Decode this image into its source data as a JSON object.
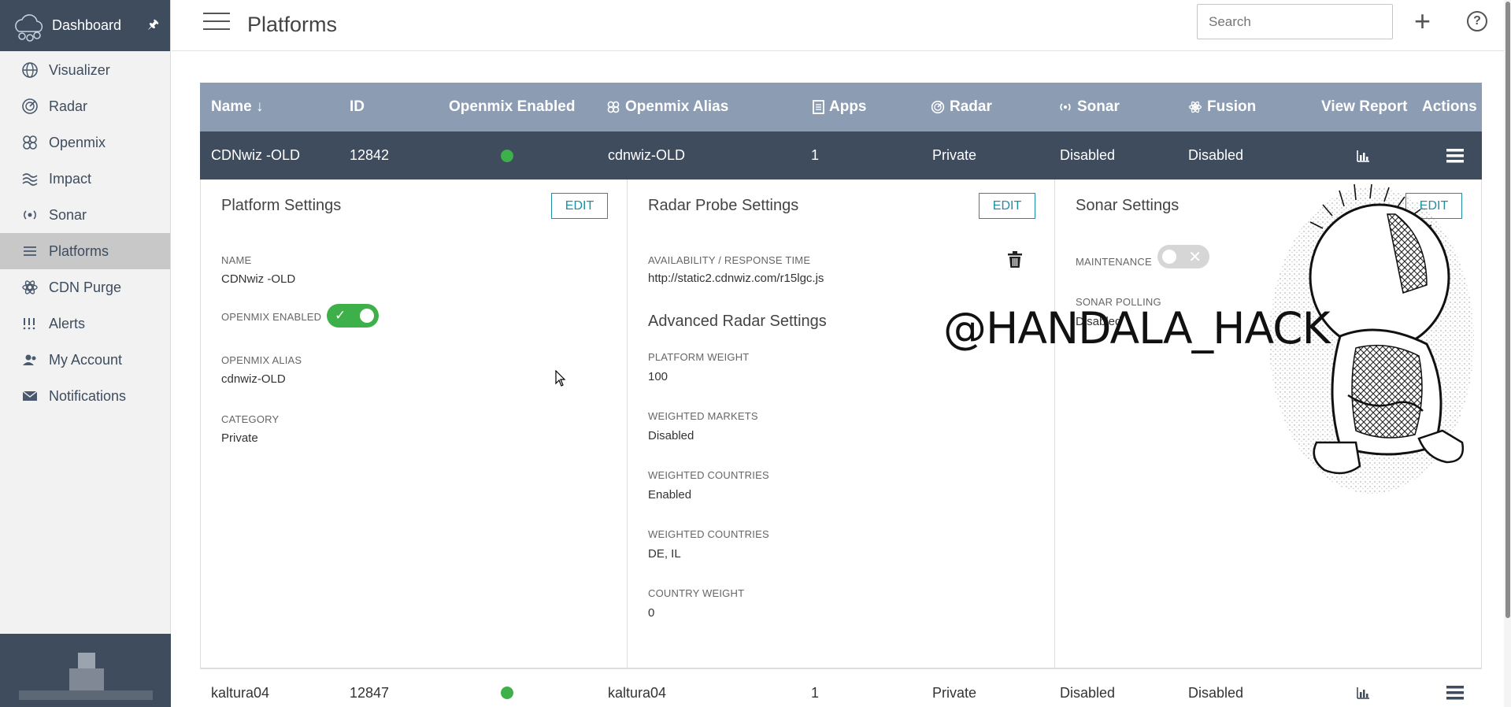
{
  "sidebar": {
    "title": "Dashboard",
    "items": [
      {
        "label": "Visualizer",
        "icon": "globe-icon"
      },
      {
        "label": "Radar",
        "icon": "radar-icon"
      },
      {
        "label": "Openmix",
        "icon": "openmix-icon"
      },
      {
        "label": "Impact",
        "icon": "impact-icon"
      },
      {
        "label": "Sonar",
        "icon": "sonar-icon"
      },
      {
        "label": "Platforms",
        "icon": "list-icon"
      },
      {
        "label": "CDN Purge",
        "icon": "purge-icon"
      },
      {
        "label": "Alerts",
        "icon": "alerts-icon"
      },
      {
        "label": "My Account",
        "icon": "account-icon"
      },
      {
        "label": "Notifications",
        "icon": "mail-icon"
      }
    ]
  },
  "header": {
    "title": "Platforms",
    "search_placeholder": "Search"
  },
  "table": {
    "columns": [
      "Name ↓",
      "ID",
      "Openmix Enabled",
      "Openmix Alias",
      "Apps",
      "Radar",
      "Sonar",
      "Fusion",
      "View Report",
      "Actions"
    ],
    "rows": [
      {
        "name": "CDNwiz -OLD",
        "id": "12842",
        "openmix_alias": "cdnwiz-OLD",
        "apps": "1",
        "radar": "Private",
        "sonar": "Disabled",
        "fusion": "Disabled"
      },
      {
        "name": "kaltura04",
        "id": "12847",
        "openmix_alias": "kaltura04",
        "apps": "1",
        "radar": "Private",
        "sonar": "Disabled",
        "fusion": "Disabled"
      }
    ]
  },
  "detail": {
    "edit_label": "EDIT",
    "platform": {
      "title": "Platform Settings",
      "name_label": "NAME",
      "name_value": "CDNwiz -OLD",
      "openmix_enabled_label": "OPENMIX ENABLED",
      "openmix_alias_label": "OPENMIX ALIAS",
      "openmix_alias_value": "cdnwiz-OLD",
      "category_label": "CATEGORY",
      "category_value": "Private"
    },
    "radar": {
      "title": "Radar Probe Settings",
      "availability_label": "AVAILABILITY / RESPONSE TIME",
      "availability_value": "http://static2.cdnwiz.com/r15lgc.js",
      "advanced_title": "Advanced Radar Settings",
      "platform_weight_label": "PLATFORM WEIGHT",
      "platform_weight_value": "100",
      "weighted_markets_label": "WEIGHTED MARKETS",
      "weighted_markets_value": "Disabled",
      "weighted_countries_label": "WEIGHTED COUNTRIES",
      "weighted_countries_value": "Enabled",
      "weighted_countries2_label": "WEIGHTED COUNTRIES",
      "weighted_countries2_value": "DE, IL",
      "country_weight_label": "COUNTRY WEIGHT",
      "country_weight_value": "0"
    },
    "sonar": {
      "title": "Sonar Settings",
      "maintenance_label": "MAINTENANCE",
      "polling_label": "SONAR POLLING",
      "polling_value": "Disabled"
    }
  },
  "overlay": {
    "text": "@HANDALA_HACK"
  },
  "colors": {
    "sidebar_head": "#3e4c5e",
    "table_header": "#8b9cb3",
    "selected_row": "#3e4c5e",
    "accent": "#1c8fa3",
    "green": "#3db049"
  }
}
